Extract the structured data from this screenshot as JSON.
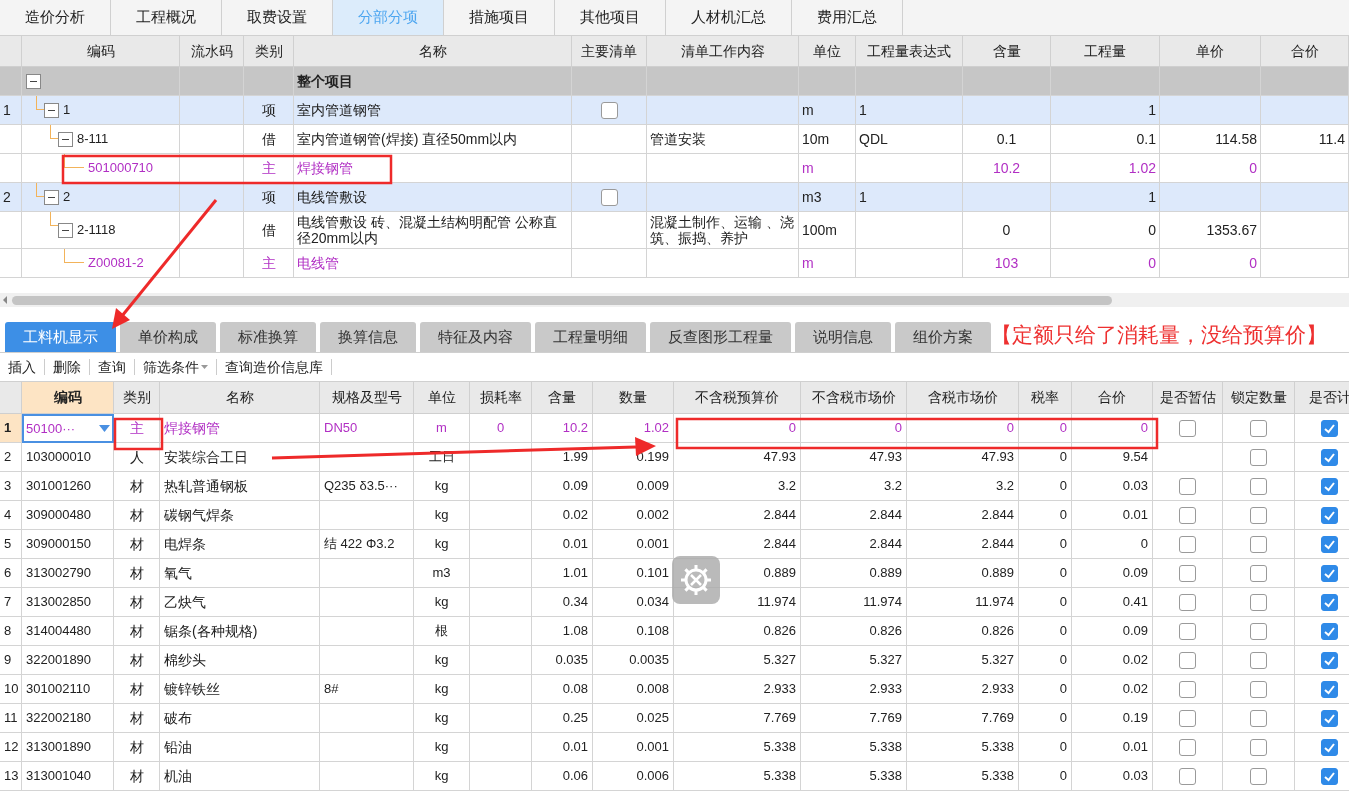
{
  "top_tabs": [
    {
      "label": "造价分析",
      "selected": false
    },
    {
      "label": "工程概况",
      "selected": false
    },
    {
      "label": "取费设置",
      "selected": false
    },
    {
      "label": "分部分项",
      "selected": true
    },
    {
      "label": "措施项目",
      "selected": false
    },
    {
      "label": "其他项目",
      "selected": false
    },
    {
      "label": "人材机汇总",
      "selected": false
    },
    {
      "label": "费用汇总",
      "selected": false
    }
  ],
  "top_table": {
    "columns": [
      "编码",
      "流水码",
      "类别",
      "名称",
      "主要清单",
      "清单工作内容",
      "单位",
      "工程量表达式",
      "含量",
      "工程量",
      "单价",
      "合价"
    ],
    "root": {
      "kind": "group",
      "name": "整个项目",
      "expanded": true,
      "children": [
        {
          "kind": "list",
          "row_no": "1",
          "code": "1",
          "type": "项",
          "name": "室内管道钢管",
          "main_list": false,
          "unit": "m",
          "expression": "1",
          "quantity": "1",
          "expanded": true,
          "children": [
            {
              "kind": "quota",
              "code": "8-111",
              "type": "借",
              "name": "室内管道钢管(焊接) 直径50mm以内",
              "work": "管道安装",
              "unit": "10m",
              "expression": "QDL",
              "content": "0.1",
              "quantity": "0.1",
              "unit_price": "114.58",
              "total": "11.4",
              "expanded": true,
              "children": [
                {
                  "kind": "material",
                  "code": "501000710",
                  "type": "主",
                  "name": "焊接钢管",
                  "unit": "m",
                  "content": "10.2",
                  "quantity": "1.02",
                  "unit_price": "0"
                }
              ]
            }
          ]
        },
        {
          "kind": "list",
          "row_no": "2",
          "code": "2",
          "type": "项",
          "name": "电线管敷设",
          "main_list": false,
          "unit": "m3",
          "expression": "1",
          "quantity": "1",
          "expanded": true,
          "children": [
            {
              "kind": "quota",
              "code": "2-1118",
              "type": "借",
              "name": "电线管敷设 砖、混凝土结构明配管 公称直径20mm以内",
              "work": "混凝土制作、运输 、浇筑、振捣、养护",
              "unit": "100m",
              "content": "0",
              "quantity": "0",
              "unit_price": "1353.67",
              "expanded": true,
              "children": [
                {
                  "kind": "material",
                  "code": "Z00081-2",
                  "type": "主",
                  "name": "电线管",
                  "unit": "m",
                  "content": "103",
                  "quantity": "0",
                  "unit_price": "0"
                }
              ]
            }
          ]
        }
      ]
    }
  },
  "bottom_tabs": [
    {
      "label": "工料机显示",
      "selected": true
    },
    {
      "label": "单价构成",
      "selected": false
    },
    {
      "label": "标准换算",
      "selected": false
    },
    {
      "label": "换算信息",
      "selected": false
    },
    {
      "label": "特征及内容",
      "selected": false
    },
    {
      "label": "工程量明细",
      "selected": false
    },
    {
      "label": "反查图形工程量",
      "selected": false
    },
    {
      "label": "说明信息",
      "selected": false
    },
    {
      "label": "组价方案",
      "selected": false
    }
  ],
  "annotation": "【定额只给了消耗量，没给预算价】",
  "toolbar": [
    {
      "label": "插入",
      "has_menu": false
    },
    {
      "label": "删除",
      "has_menu": false
    },
    {
      "label": "查询",
      "has_menu": false
    },
    {
      "label": "筛选条件",
      "has_menu": true
    },
    {
      "label": "查询造价信息库",
      "has_menu": false
    }
  ],
  "bottom_table": {
    "columns": [
      {
        "label": "编码",
        "selected": true
      },
      {
        "label": "类别",
        "selected": false
      },
      {
        "label": "名称",
        "selected": false
      },
      {
        "label": "规格及型号",
        "selected": false
      },
      {
        "label": "单位",
        "selected": false
      },
      {
        "label": "损耗率",
        "selected": false
      },
      {
        "label": "含量",
        "selected": false
      },
      {
        "label": "数量",
        "selected": false
      },
      {
        "label": "不含税预算价",
        "selected": false
      },
      {
        "label": "不含税市场价",
        "selected": false
      },
      {
        "label": "含税市场价",
        "selected": false
      },
      {
        "label": "税率",
        "selected": false
      },
      {
        "label": "合价",
        "selected": false
      },
      {
        "label": "是否暂估",
        "selected": false
      },
      {
        "label": "锁定数量",
        "selected": false
      },
      {
        "label": "是否计",
        "selected": false
      }
    ],
    "rows": [
      {
        "no": "1",
        "kind": "main_material",
        "selected": true,
        "code": "50100···",
        "type": "主",
        "name": "焊接钢管",
        "spec": "DN50",
        "unit": "m",
        "loss_rate": "0",
        "content": "10.2",
        "quantity": "1.02",
        "price_ex_tax": "0",
        "market_ex_tax": "0",
        "market_inc_tax": "0",
        "tax_rate": "0",
        "total": "0",
        "estimate": false,
        "locked": false,
        "counted": true
      },
      {
        "no": "2",
        "kind": "normal",
        "selected": false,
        "code": "103000010",
        "type": "人",
        "name": "安装综合工日",
        "unit": "工日",
        "content": "1.99",
        "quantity": "0.199",
        "price_ex_tax": "47.93",
        "market_ex_tax": "47.93",
        "market_inc_tax": "47.93",
        "tax_rate": "0",
        "total": "9.54",
        "locked": false,
        "counted": true
      },
      {
        "no": "3",
        "kind": "normal",
        "selected": false,
        "code": "301001260",
        "type": "材",
        "name": "热轧普通钢板",
        "spec": "Q235 δ3.5···",
        "unit": "kg",
        "content": "0.09",
        "quantity": "0.009",
        "price_ex_tax": "3.2",
        "market_ex_tax": "3.2",
        "market_inc_tax": "3.2",
        "tax_rate": "0",
        "total": "0.03",
        "estimate": false,
        "locked": false,
        "counted": true
      },
      {
        "no": "4",
        "kind": "normal",
        "selected": false,
        "code": "309000480",
        "type": "材",
        "name": "碳钢气焊条",
        "unit": "kg",
        "content": "0.02",
        "quantity": "0.002",
        "price_ex_tax": "2.844",
        "market_ex_tax": "2.844",
        "market_inc_tax": "2.844",
        "tax_rate": "0",
        "total": "0.01",
        "estimate": false,
        "locked": false,
        "counted": true
      },
      {
        "no": "5",
        "kind": "normal",
        "selected": false,
        "code": "309000150",
        "type": "材",
        "name": "电焊条",
        "spec": "结 422 Φ3.2",
        "unit": "kg",
        "content": "0.01",
        "quantity": "0.001",
        "price_ex_tax": "2.844",
        "market_ex_tax": "2.844",
        "market_inc_tax": "2.844",
        "tax_rate": "0",
        "total": "0",
        "estimate": false,
        "locked": false,
        "counted": true
      },
      {
        "no": "6",
        "kind": "normal",
        "selected": false,
        "code": "313002790",
        "type": "材",
        "name": "氧气",
        "unit": "m3",
        "content": "1.01",
        "quantity": "0.101",
        "price_ex_tax": "0.889",
        "market_ex_tax": "0.889",
        "market_inc_tax": "0.889",
        "tax_rate": "0",
        "total": "0.09",
        "estimate": false,
        "locked": false,
        "counted": true
      },
      {
        "no": "7",
        "kind": "normal",
        "selected": false,
        "code": "313002850",
        "type": "材",
        "name": "乙炔气",
        "unit": "kg",
        "content": "0.34",
        "quantity": "0.034",
        "price_ex_tax": "11.974",
        "market_ex_tax": "11.974",
        "market_inc_tax": "11.974",
        "tax_rate": "0",
        "total": "0.41",
        "estimate": false,
        "locked": false,
        "counted": true
      },
      {
        "no": "8",
        "kind": "normal",
        "selected": false,
        "code": "314004480",
        "type": "材",
        "name": "锯条(各种规格)",
        "unit": "根",
        "content": "1.08",
        "quantity": "0.108",
        "price_ex_tax": "0.826",
        "market_ex_tax": "0.826",
        "market_inc_tax": "0.826",
        "tax_rate": "0",
        "total": "0.09",
        "estimate": false,
        "locked": false,
        "counted": true
      },
      {
        "no": "9",
        "kind": "normal",
        "selected": false,
        "code": "322001890",
        "type": "材",
        "name": "棉纱头",
        "unit": "kg",
        "content": "0.035",
        "quantity": "0.0035",
        "price_ex_tax": "5.327",
        "market_ex_tax": "5.327",
        "market_inc_tax": "5.327",
        "tax_rate": "0",
        "total": "0.02",
        "estimate": false,
        "locked": false,
        "counted": true
      },
      {
        "no": "10",
        "kind": "normal",
        "selected": false,
        "code": "301002110",
        "type": "材",
        "name": "镀锌铁丝",
        "spec": "8#",
        "unit": "kg",
        "content": "0.08",
        "quantity": "0.008",
        "price_ex_tax": "2.933",
        "market_ex_tax": "2.933",
        "market_inc_tax": "2.933",
        "tax_rate": "0",
        "total": "0.02",
        "estimate": false,
        "locked": false,
        "counted": true
      },
      {
        "no": "11",
        "kind": "normal",
        "selected": false,
        "code": "322002180",
        "type": "材",
        "name": "破布",
        "unit": "kg",
        "content": "0.25",
        "quantity": "0.025",
        "price_ex_tax": "7.769",
        "market_ex_tax": "7.769",
        "market_inc_tax": "7.769",
        "tax_rate": "0",
        "total": "0.19",
        "estimate": false,
        "locked": false,
        "counted": true
      },
      {
        "no": "12",
        "kind": "normal",
        "selected": false,
        "code": "313001890",
        "type": "材",
        "name": "铅油",
        "unit": "kg",
        "content": "0.01",
        "quantity": "0.001",
        "price_ex_tax": "5.338",
        "market_ex_tax": "5.338",
        "market_inc_tax": "5.338",
        "tax_rate": "0",
        "total": "0.01",
        "estimate": false,
        "locked": false,
        "counted": true
      },
      {
        "no": "13",
        "kind": "normal",
        "selected": false,
        "code": "313001040",
        "type": "材",
        "name": "机油",
        "unit": "kg",
        "content": "0.06",
        "quantity": "0.006",
        "price_ex_tax": "5.338",
        "market_ex_tax": "5.338",
        "market_inc_tax": "5.338",
        "tax_rate": "0",
        "total": "0.03",
        "estimate": false,
        "locked": false,
        "counted": true
      }
    ]
  }
}
